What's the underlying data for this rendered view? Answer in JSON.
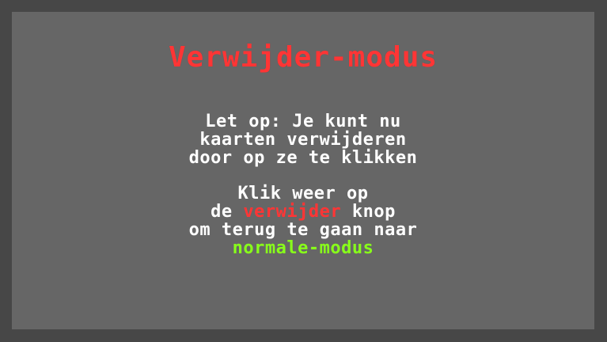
{
  "title": "Verwijder-modus",
  "warning": {
    "line1": "Let op: Je kunt nu",
    "line2": "kaarten verwijderen",
    "line3": "door op ze te klikken"
  },
  "instruction": {
    "line1": "Klik weer op",
    "line2_prefix": "de ",
    "line2_highlight": "verwijder",
    "line2_suffix": " knop",
    "line3": "om terug te gaan naar",
    "line4": "normale-modus"
  },
  "colors": {
    "background": "#474747",
    "panel": "#666666",
    "title": "#ff3535",
    "text": "#ffffff",
    "highlight_red": "#ff3535",
    "highlight_green": "#88ff1a"
  }
}
